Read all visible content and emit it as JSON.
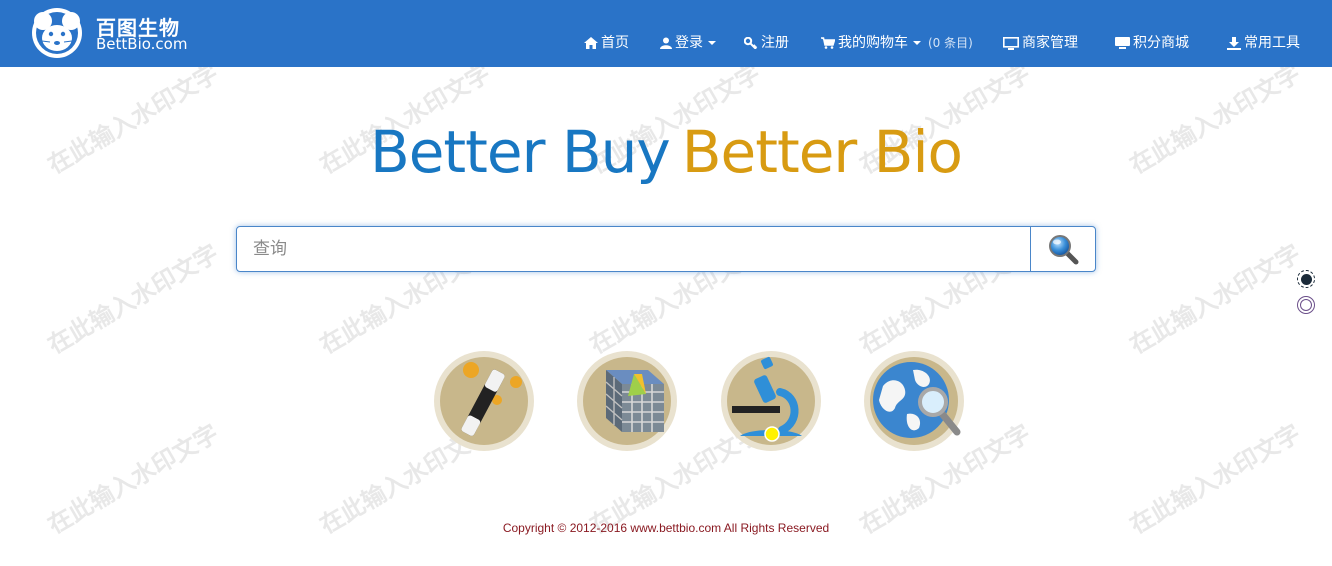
{
  "header": {
    "logo_cn": "百图生物",
    "logo_en": "BettBio.com",
    "nav": {
      "home": "首页",
      "login": "登录",
      "register": "注册",
      "cart": "我的购物车",
      "cart_count": "(0 条目)",
      "merchant": "商家管理",
      "points_mall": "积分商城",
      "tools": "常用工具"
    }
  },
  "slogan": {
    "part1": "Better Buy",
    "part2": "Better Bio"
  },
  "search": {
    "placeholder": "查询"
  },
  "footer": {
    "copyright": "Copyright © 2012-2016 www.bettbio.com All Rights Reserved"
  },
  "watermark": {
    "text": "在此输入水印文字"
  },
  "colors": {
    "navbar": "#2a73c8",
    "slogan_blue": "#1877c2",
    "slogan_gold": "#d89b12",
    "footer_text": "#8a1a22"
  },
  "icons": {
    "tool1": "magic-wand-icon",
    "tool2": "product-cube-icon",
    "tool3": "microscope-icon",
    "tool4": "globe-search-icon"
  }
}
